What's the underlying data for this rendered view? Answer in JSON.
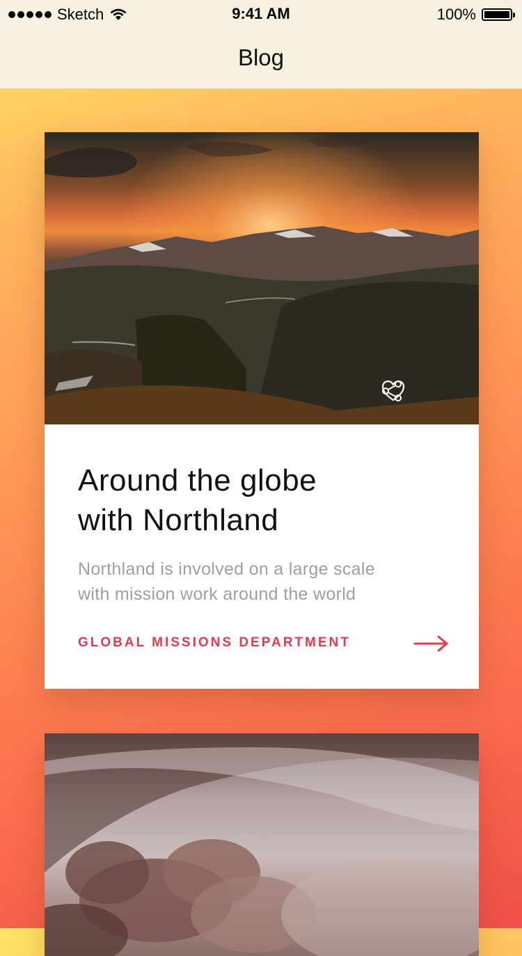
{
  "status_bar": {
    "carrier": "Sketch",
    "time": "9:41 AM",
    "battery": "100%"
  },
  "nav": {
    "title": "Blog"
  },
  "posts": [
    {
      "title_line1": "Around the globe",
      "title_line2": "with Northland",
      "excerpt_line1": "Northland is involved on a large scale",
      "excerpt_line2": "with mission work around the world",
      "department": "GLOBAL MISSIONS DEPARTMENT",
      "actions": [
        "share-icon",
        "heart-icon"
      ],
      "link_icon": "arrow-right-icon"
    },
    {
      "title_line1": "",
      "title_line2": ""
    }
  ],
  "colors": {
    "accent": "#e5394d",
    "nav_background": "#f7f2df",
    "gradient_top": "#ffe566",
    "gradient_bottom": "#f0504a",
    "title_text": "#111111",
    "excerpt_text": "#9e9e9e"
  }
}
